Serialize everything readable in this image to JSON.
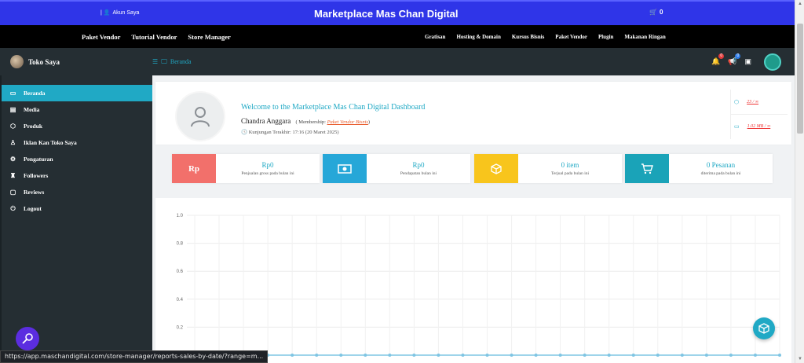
{
  "topbar": {
    "account": "Akun Saya",
    "brand": "Marketplace Mas Chan Digital",
    "cart": "0"
  },
  "nav": {
    "left": [
      "Paket Vendor",
      "Tutorial Vendor",
      "Store Manager"
    ],
    "right": [
      "Gratisan",
      "Hosting & Domain",
      "Kursus Bisnis",
      "Paket Vendor",
      "Plugin",
      "Makanan Ringan"
    ]
  },
  "header": {
    "store_name": "Toko Saya",
    "breadcrumb": "Beranda",
    "notif_count": "0",
    "announce_count": "0"
  },
  "sidebar": {
    "items": [
      {
        "label": "Beranda",
        "icon": "monitor-icon"
      },
      {
        "label": "Media",
        "icon": "image-icon"
      },
      {
        "label": "Produk",
        "icon": "box-icon"
      },
      {
        "label": "Iklan Kan Toko Saya",
        "icon": "user-icon"
      },
      {
        "label": "Pengaturan",
        "icon": "gears-icon"
      },
      {
        "label": "Followers",
        "icon": "gift-icon"
      },
      {
        "label": "Reviews",
        "icon": "comment-icon"
      },
      {
        "label": "Logout",
        "icon": "power-icon"
      }
    ]
  },
  "welcome": {
    "title": "Welcome to the Marketplace Mas Chan Digital Dashboard",
    "name": "Chandra Anggara",
    "membership_prefix": "( Membership:",
    "membership_link": "Paket Vendor Bisnis",
    "membership_suffix": ")",
    "last_visit": "Kunjungan Terakhir: 17:16 (20 Maret 2025)",
    "stat1": "23 / ∞",
    "stat2": "1.02 MB / ∞"
  },
  "cards": [
    {
      "icon_label": "Rp",
      "value": "Rp0",
      "label": "Penjualan gross pada bulan ini",
      "color": "#f2706b"
    },
    {
      "icon_label": "",
      "value": "Rp0",
      "label": "Pendapatan bulan ini",
      "color": "#26a7d8"
    },
    {
      "icon_label": "",
      "value": "0 item",
      "label": "Terjual pada bulan ini",
      "color": "#f8c51c"
    },
    {
      "icon_label": "",
      "value": "0 Pesanan",
      "label": "diterima pada bulan ini",
      "color": "#1aa3b8"
    }
  ],
  "chart_data": {
    "type": "line",
    "y_ticks": [
      "1.0",
      "0.8",
      "0.6",
      "0.4",
      "0.2"
    ],
    "ylim": [
      0,
      1
    ],
    "series": [
      {
        "values": [
          0,
          0,
          0,
          0,
          0,
          0,
          0,
          0,
          0,
          0,
          0,
          0,
          0,
          0,
          0,
          0,
          0,
          0,
          0,
          0,
          0,
          0,
          0,
          0,
          0
        ]
      }
    ],
    "grid": true
  },
  "status_url": "https://app.maschandigital.com/store-manager/reports-sales-by-date/?range=m..."
}
